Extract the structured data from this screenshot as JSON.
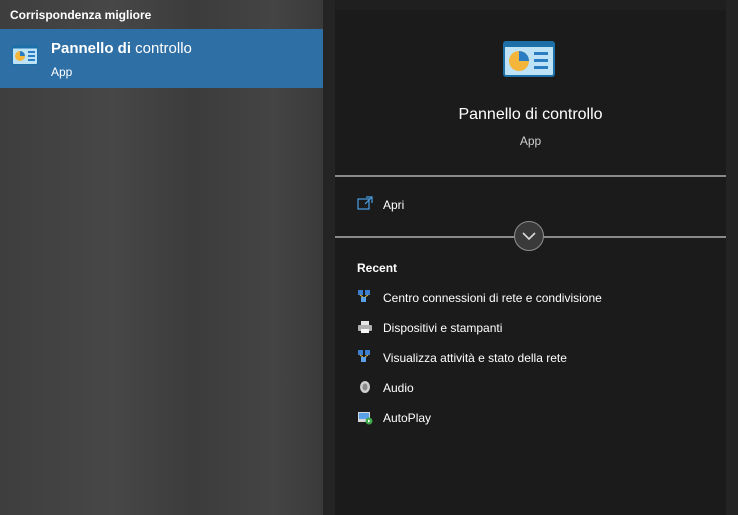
{
  "results": {
    "section_header": "Corrispondenza migliore",
    "best_match": {
      "title_bold": "Pannello di",
      "title_rest": " controllo",
      "subtitle": "App"
    }
  },
  "detail": {
    "app_name": "Pannello di controllo",
    "app_type": "App",
    "actions": [
      {
        "label": "Apri",
        "icon": "open-window-icon"
      }
    ],
    "expand_icon": "chevron-down-icon",
    "recent": {
      "title": "Recent",
      "items": [
        {
          "label": "Centro connessioni di rete e condivisione",
          "icon": "network-center-icon"
        },
        {
          "label": "Dispositivi e stampanti",
          "icon": "printer-icon"
        },
        {
          "label": "Visualizza attività e stato della rete",
          "icon": "network-status-icon"
        },
        {
          "label": "Audio",
          "icon": "speaker-icon"
        },
        {
          "label": "AutoPlay",
          "icon": "autoplay-icon"
        }
      ]
    }
  },
  "colors": {
    "selection": "#2e6fa6",
    "pane_background": "#1b1b1b",
    "separator": "#8a8a8a"
  }
}
